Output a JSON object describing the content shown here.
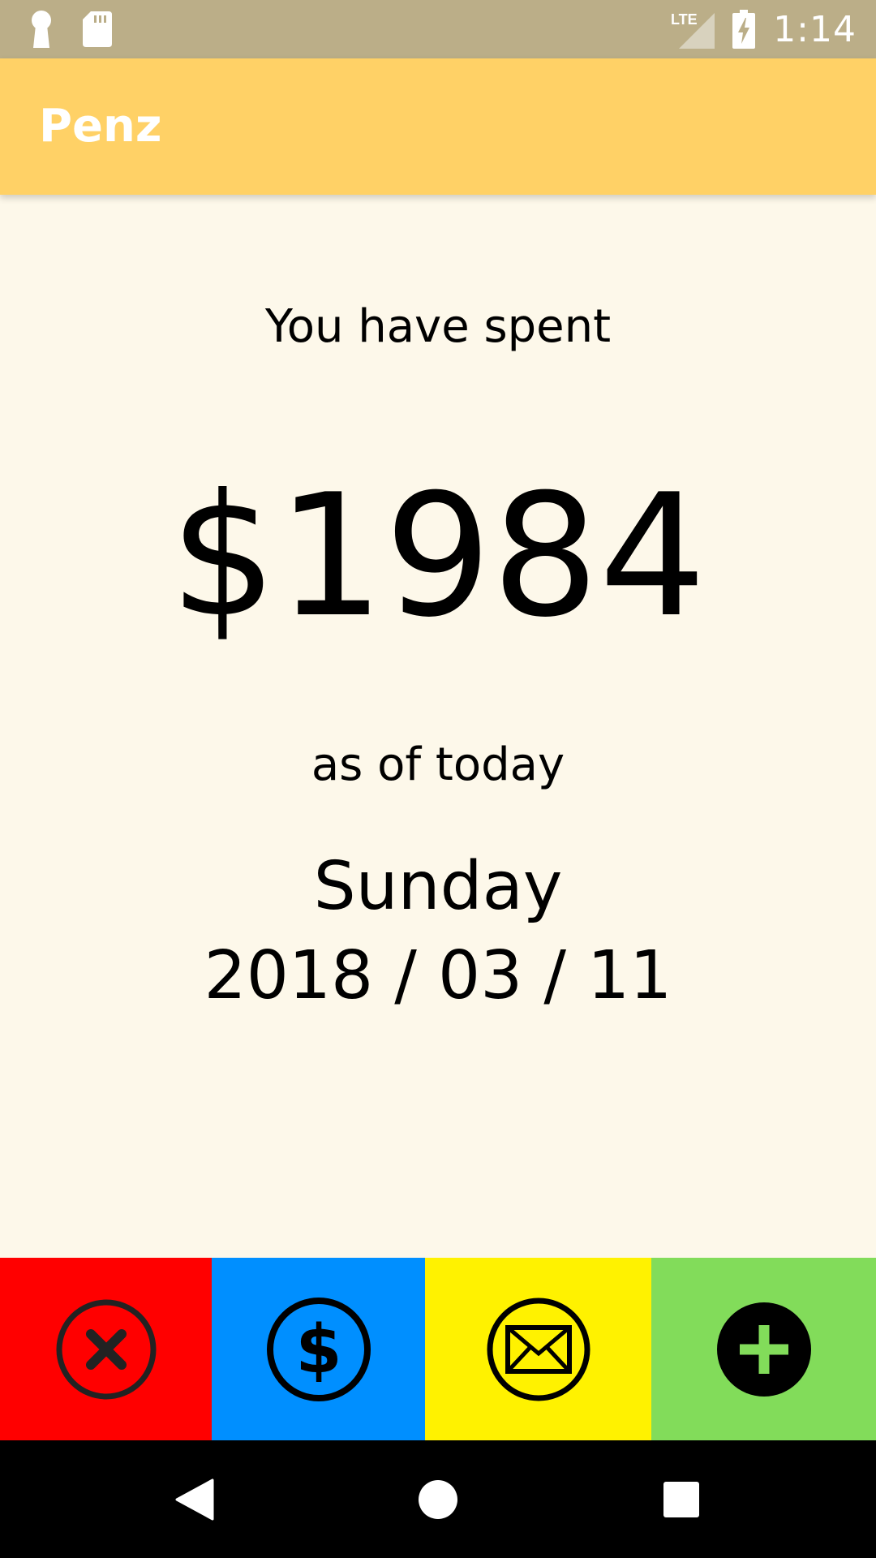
{
  "status_bar": {
    "network": "LTE",
    "time": "1:14",
    "icons": [
      "keyhole-icon",
      "sd-card-icon",
      "signal-icon",
      "battery-charging-icon"
    ]
  },
  "app_bar": {
    "title": "Penz"
  },
  "summary": {
    "label": "You have spent",
    "amount": "$1984",
    "as_of": "as of today",
    "weekday": "Sunday",
    "date": "2018 / 03 / 11"
  },
  "actions": [
    {
      "name": "cancel",
      "icon": "close-circle-icon",
      "color": "#FF0000"
    },
    {
      "name": "expense",
      "icon": "dollar-circle-icon",
      "color": "#008FFF"
    },
    {
      "name": "message",
      "icon": "envelope-circle-icon",
      "color": "#FFF200"
    },
    {
      "name": "add",
      "icon": "plus-circle-icon",
      "color": "#82DC5A"
    }
  ],
  "nav_bar": {
    "buttons": [
      "back",
      "home",
      "recents"
    ]
  },
  "colors": {
    "status_bar": "#BBAE88",
    "app_bar": "#FFD166",
    "background": "#FDF8EA",
    "nav_bar": "#000000"
  }
}
